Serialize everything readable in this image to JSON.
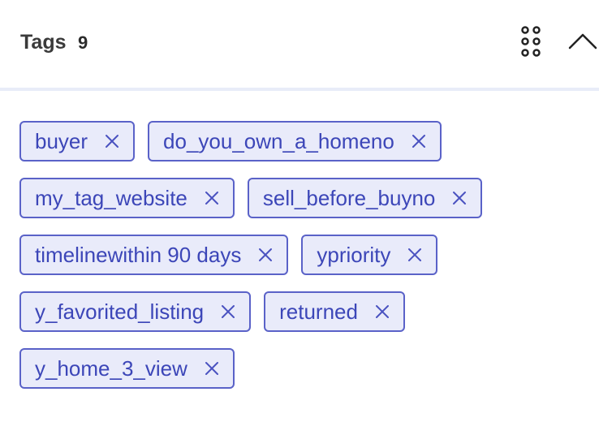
{
  "header": {
    "title": "Tags",
    "count": "9"
  },
  "icons": {
    "grid": "grid-dots-icon",
    "collapse": "chevron-up-icon",
    "remove": "close-icon"
  },
  "colors": {
    "tag_bg": "#e9ebfa",
    "tag_border": "#5a62c8",
    "tag_text": "#3c46b8",
    "divider": "#e8ecf8"
  },
  "tags": [
    {
      "label": "buyer"
    },
    {
      "label": "do_you_own_a_homeno"
    },
    {
      "label": "my_tag_website"
    },
    {
      "label": "sell_before_buyno"
    },
    {
      "label": "timelinewithin 90 days"
    },
    {
      "label": "ypriority"
    },
    {
      "label": "y_favorited_listing"
    },
    {
      "label": "returned"
    },
    {
      "label": "y_home_3_view"
    }
  ]
}
